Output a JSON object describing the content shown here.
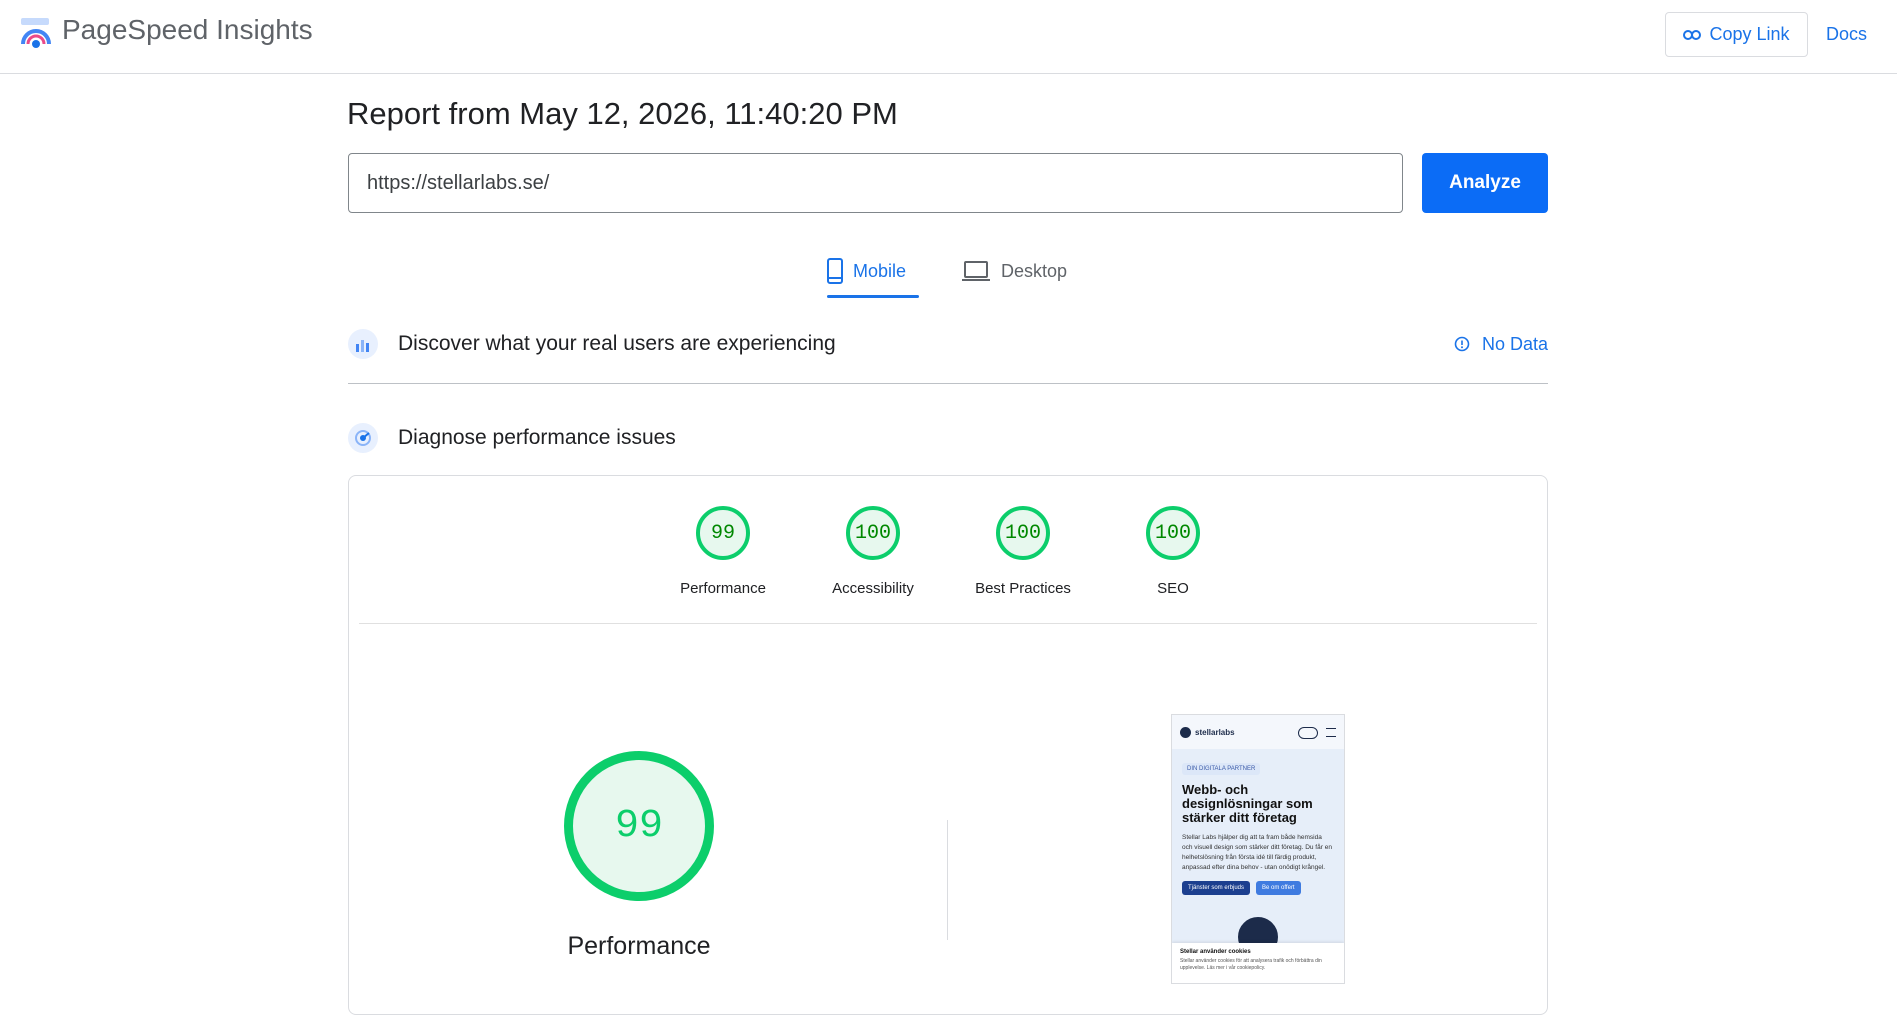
{
  "header": {
    "app_title": "PageSpeed Insights",
    "copy_link_label": "Copy Link",
    "docs_label": "Docs"
  },
  "report": {
    "title": "Report from May 12, 2026, 11:40:20 PM",
    "url_value": "https://stellarlabs.se/",
    "analyze_label": "Analyze"
  },
  "tabs": [
    {
      "label": "Mobile",
      "icon": "smartphone-icon",
      "selected": true
    },
    {
      "label": "Desktop",
      "icon": "laptop-icon",
      "selected": false
    }
  ],
  "field_data": {
    "title": "Discover what your real users are experiencing",
    "status_label": "No Data",
    "status_icon": "info-icon"
  },
  "lab_data": {
    "title": "Diagnose performance issues"
  },
  "scores": [
    {
      "label": "Performance",
      "value": "99"
    },
    {
      "label": "Accessibility",
      "value": "100"
    },
    {
      "label": "Best Practices",
      "value": "100"
    },
    {
      "label": "SEO",
      "value": "100"
    }
  ],
  "main_score": {
    "value": "99",
    "label": "Performance"
  },
  "screenshot": {
    "brand": "stellarlabs",
    "badge": "DIN DIGITALA PARTNER",
    "heading": "Webb- och designlösningar som stärker ditt företag",
    "body": "Stellar Labs hjälper dig att ta fram både hemsida och visuell design som stärker ditt företag. Du får en helhetslösning från första idé till färdig produkt, anpassad efter dina behov - utan onödigt krångel.",
    "button_primary": "Tjänster som erbjuds",
    "button_secondary": "Be om offert",
    "cookie_title": "Stellar använder cookies",
    "cookie_text": "Stellar använder cookies för att analysera trafik och förbättra din upplevelse. Läs mer i vår cookiepolicy."
  },
  "colors": {
    "accent": "#1a73e8",
    "analyze_button": "#0b6cf6",
    "score_good": "#0cce6b",
    "score_good_bg": "#e7f8ee"
  }
}
